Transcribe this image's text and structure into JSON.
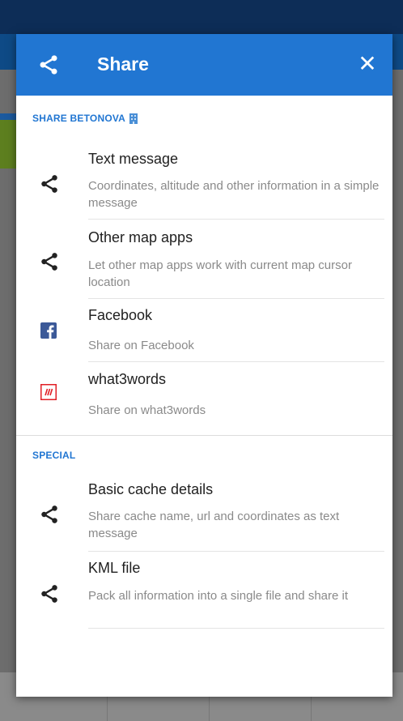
{
  "dialog": {
    "title": "Share",
    "close_label": "✕"
  },
  "sections": [
    {
      "header": "SHARE BETONOVA",
      "items": [
        {
          "title": "Text message",
          "desc": "Coordinates, altitude and other information in a simple message",
          "icon": "share-icon"
        },
        {
          "title": "Other map apps",
          "desc": "Let other map apps work with current map cursor location",
          "icon": "share-icon"
        },
        {
          "title": "Facebook",
          "desc": "Share on Facebook",
          "icon": "facebook-icon"
        },
        {
          "title": "what3words",
          "desc": "Share on what3words",
          "icon": "what3words-icon"
        }
      ]
    },
    {
      "header": "SPECIAL",
      "items": [
        {
          "title": "Basic cache details",
          "desc": "Share cache name, url and coordinates as text message",
          "icon": "share-icon"
        },
        {
          "title": "KML file",
          "desc": "Pack all information into a single file and share it",
          "icon": "share-icon"
        }
      ]
    }
  ],
  "colors": {
    "header_bg": "#2176d2",
    "accent": "#2176d2",
    "facebook": "#3b5998",
    "what3words": "#e11f26"
  }
}
